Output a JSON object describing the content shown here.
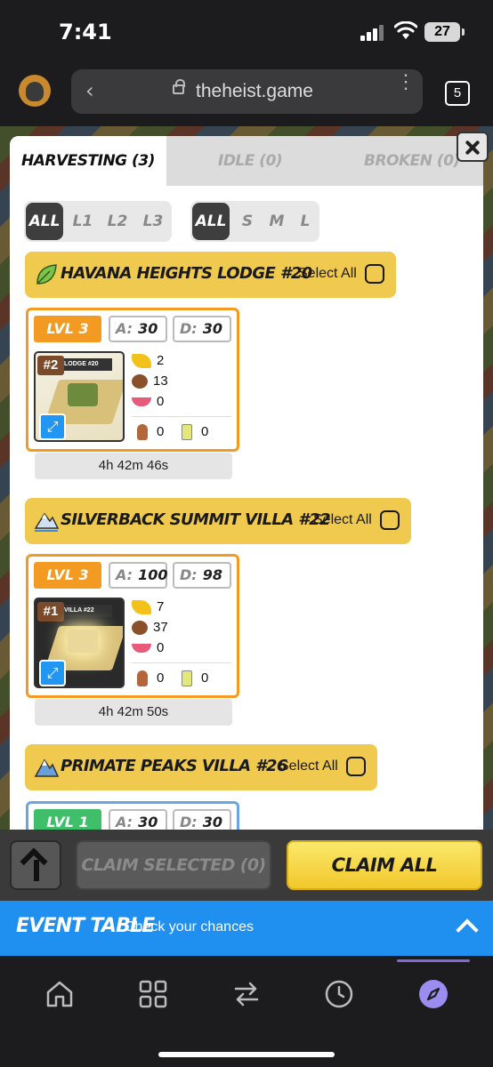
{
  "status_bar": {
    "time": "7:41",
    "battery": "27"
  },
  "browser": {
    "url": "theheist.game",
    "tab_count": "5"
  },
  "tabs": [
    {
      "label": "HARVESTING (3)"
    },
    {
      "label": "IDLE (0)"
    },
    {
      "label": "BROKEN (0)"
    }
  ],
  "level_filters": [
    "ALL",
    "L1",
    "L2",
    "L3"
  ],
  "size_filters": [
    "ALL",
    "S",
    "M",
    "L"
  ],
  "properties": [
    {
      "name": "HAVANA HEIGHTS LODGE #20",
      "select_all": "Select All",
      "icon": "leaf-icon",
      "card": {
        "level": "LVL 3",
        "attack_key": "A:",
        "attack": "30",
        "defense_key": "D:",
        "defense": "30",
        "rank": "#2",
        "banner": "LODGE #20",
        "bananas": "2",
        "seeds": "13",
        "bowls": "0",
        "clubs": "0",
        "lighters": "0",
        "timer": "4h 42m 46s"
      }
    },
    {
      "name": "SILVERBACK SUMMIT VILLA #22",
      "select_all": "Select All",
      "icon": "mountain-snow-icon",
      "card": {
        "level": "LVL 3",
        "attack_key": "A:",
        "attack": "100",
        "defense_key": "D:",
        "defense": "98",
        "rank": "#1",
        "banner": "VILLA #22",
        "bananas": "7",
        "seeds": "37",
        "bowls": "0",
        "clubs": "0",
        "lighters": "0",
        "timer": "4h 42m 50s"
      }
    },
    {
      "name": "PRIMATE PEAKS VILLA #26",
      "select_all": "Select All",
      "icon": "mountain-icon",
      "card": {
        "level": "LVL 1",
        "attack_key": "A:",
        "attack": "30",
        "defense_key": "D:",
        "defense": "30"
      }
    }
  ],
  "actions": {
    "claim_selected": "CLAIM SELECTED (0)",
    "claim_all": "CLAIM ALL"
  },
  "event_table": {
    "title": "EVENT TABLE",
    "subtitle": "Check your chances"
  },
  "nav": [
    "home-icon",
    "grid-icon",
    "swap-icon",
    "clock-icon",
    "compass-icon"
  ],
  "colors": {
    "accent_yellow": "#f0c94f",
    "card_orange": "#f39a22",
    "event_blue": "#1f8ff0",
    "nav_active": "#9b8cf0"
  }
}
